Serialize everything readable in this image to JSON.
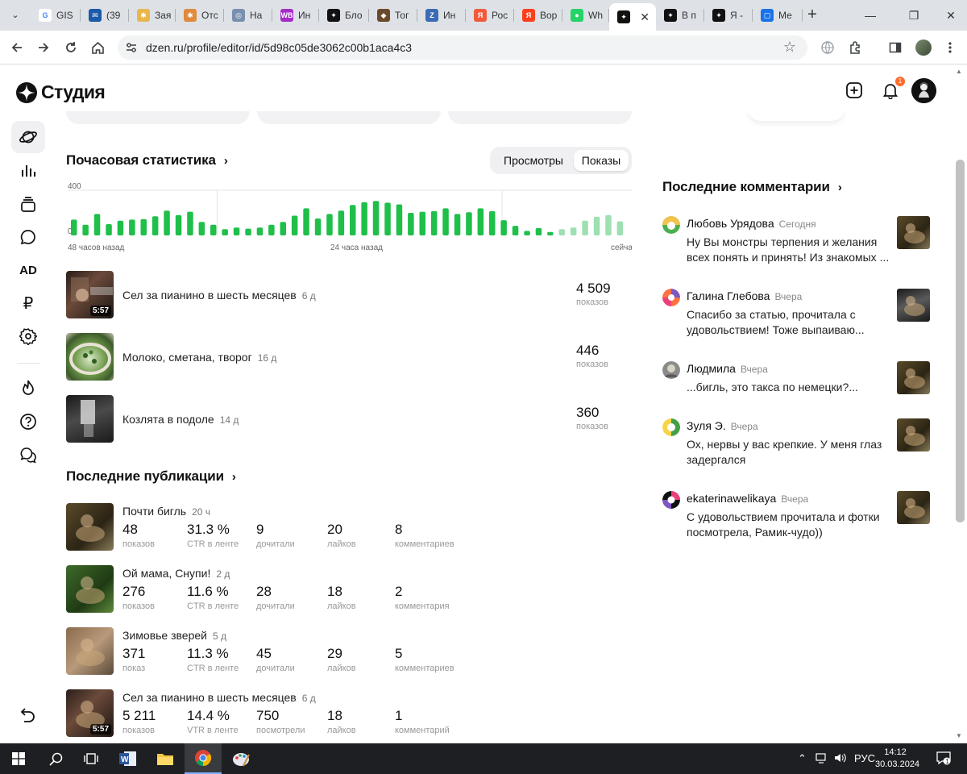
{
  "browser": {
    "tabs": [
      {
        "label": "GIS",
        "fav": "G",
        "color": "#4285f4",
        "fcolor": "#fff"
      },
      {
        "label": "(39",
        "fav": "✉",
        "color": "#1a5aa8",
        "fcolor": "#fff"
      },
      {
        "label": "Зая",
        "fav": "✱",
        "color": "#e8b64c",
        "fcolor": "#fff"
      },
      {
        "label": "Отс",
        "fav": "✱",
        "color": "#e08a3c",
        "fcolor": "#fff"
      },
      {
        "label": "На",
        "fav": "◎",
        "color": "#7a8fb0",
        "fcolor": "#fff"
      },
      {
        "label": "Ин",
        "fav": "WB",
        "color": "#a72ac9",
        "fcolor": "#fff"
      },
      {
        "label": "Бло",
        "fav": "✦",
        "color": "#111",
        "fcolor": "#fff"
      },
      {
        "label": "Тог",
        "fav": "◆",
        "color": "#6b4a2b",
        "fcolor": "#fff"
      },
      {
        "label": "Ин",
        "fav": "Z",
        "color": "#3b6bb3",
        "fcolor": "#fff"
      },
      {
        "label": "Рос",
        "fav": "Я",
        "color": "#f25a3c",
        "fcolor": "#fff"
      },
      {
        "label": "Вор",
        "fav": "Я",
        "color": "#fc3f1d",
        "fcolor": "#fff"
      },
      {
        "label": "Wh",
        "fav": "●",
        "color": "#25d366",
        "fcolor": "#fff"
      },
      {
        "label": "",
        "fav": "✦",
        "color": "#111",
        "fcolor": "#fff",
        "active": true
      },
      {
        "label": "В п",
        "fav": "✦",
        "color": "#111",
        "fcolor": "#fff"
      },
      {
        "label": "Я -",
        "fav": "✦",
        "color": "#111",
        "fcolor": "#fff"
      },
      {
        "label": "Ме",
        "fav": "▢",
        "color": "#1a73e8",
        "fcolor": "#fff"
      }
    ],
    "url": "dzen.ru/profile/editor/id/5d98c05de3062c00b1aca4c3"
  },
  "app": {
    "logo_text": "Студия",
    "notif_count": "1"
  },
  "hourly": {
    "title": "Почасовая статистика",
    "toggle": {
      "views": "Просмотры",
      "impressions": "Показы"
    }
  },
  "chart_data": {
    "type": "bar",
    "ylim": [
      0,
      400
    ],
    "yticks": [
      "400",
      "0"
    ],
    "xlabels": [
      "48 часов назад",
      "24 часа назад",
      "сейча"
    ],
    "values": [
      140,
      95,
      190,
      100,
      130,
      140,
      145,
      170,
      220,
      180,
      210,
      120,
      95,
      55,
      70,
      60,
      70,
      95,
      120,
      175,
      240,
      150,
      190,
      220,
      270,
      295,
      305,
      290,
      275,
      200,
      210,
      215,
      240,
      190,
      205,
      240,
      215,
      135,
      85,
      40,
      65,
      30,
      55,
      70,
      130,
      165,
      180,
      125
    ],
    "faded_from": 42
  },
  "top_videos": [
    {
      "title": "Сел за пианино в шесть месяцев",
      "age": "6 д",
      "value": "4 509",
      "unit": "показов",
      "duration": "5:57"
    },
    {
      "title": "Молоко, сметана, творог",
      "age": "16 д",
      "value": "446",
      "unit": "показов",
      "duration": ""
    },
    {
      "title": "Козлята в подоле",
      "age": "14 д",
      "value": "360",
      "unit": "показов",
      "duration": ""
    }
  ],
  "recent": {
    "title": "Последние публикации",
    "items": [
      {
        "title": "Почти бигль",
        "age": "20 ч",
        "duration": "",
        "metrics": [
          {
            "v": "48",
            "l": "показов"
          },
          {
            "v": "31.3 %",
            "l": "CTR в ленте"
          },
          {
            "v": "9",
            "l": "дочитали"
          },
          {
            "v": "20",
            "l": "лайков"
          },
          {
            "v": "8",
            "l": "комментариев"
          }
        ]
      },
      {
        "title": "Ой мама, Снупи!",
        "age": "2 д",
        "duration": "",
        "metrics": [
          {
            "v": "276",
            "l": "показов"
          },
          {
            "v": "11.6 %",
            "l": "CTR в ленте"
          },
          {
            "v": "28",
            "l": "дочитали"
          },
          {
            "v": "18",
            "l": "лайков"
          },
          {
            "v": "2",
            "l": "комментария"
          }
        ]
      },
      {
        "title": "Зимовье зверей",
        "age": "5 д",
        "duration": "",
        "metrics": [
          {
            "v": "371",
            "l": "показ"
          },
          {
            "v": "11.3 %",
            "l": "CTR в ленте"
          },
          {
            "v": "45",
            "l": "дочитали"
          },
          {
            "v": "29",
            "l": "лайков"
          },
          {
            "v": "5",
            "l": "комментариев"
          }
        ]
      },
      {
        "title": "Сел за пианино в шесть месяцев",
        "age": "6 д",
        "duration": "5:57",
        "metrics": [
          {
            "v": "5 211",
            "l": "показов"
          },
          {
            "v": "14.4 %",
            "l": "VTR в ленте"
          },
          {
            "v": "750",
            "l": "посмотрели"
          },
          {
            "v": "18",
            "l": "лайков"
          },
          {
            "v": "1",
            "l": "комментарий"
          }
        ]
      }
    ]
  },
  "comments": {
    "title": "Последние комментарии",
    "items": [
      {
        "name": "Любовь Урядова",
        "when": "Сегодня",
        "text": "Ну Вы монстры терпения и желания всех понять и принять! Из знакомых ..."
      },
      {
        "name": "Галина Глебова",
        "when": "Вчера",
        "text": "Спасибо за статью, прочитала с удовольствием! Тоже выпаиваю..."
      },
      {
        "name": "Людмила",
        "when": "Вчера",
        "text": "...бигль, это такса по немецки?..."
      },
      {
        "name": "Зуля Э.",
        "when": "Вчера",
        "text": "Ох, нервы у вас крепкие. У меня глаз задергался"
      },
      {
        "name": "ekaterinawelikaya",
        "when": "Вчера",
        "text": "С удовольствием прочитала и фотки посмотрела, Рамик-чудо))"
      }
    ]
  },
  "taskbar": {
    "lang": "РУС",
    "time": "14:12",
    "date": "30.03.2024",
    "notif": "1"
  },
  "colors": {
    "bar": "#1fbf4a",
    "bar_faded": "#9ee0b1"
  }
}
